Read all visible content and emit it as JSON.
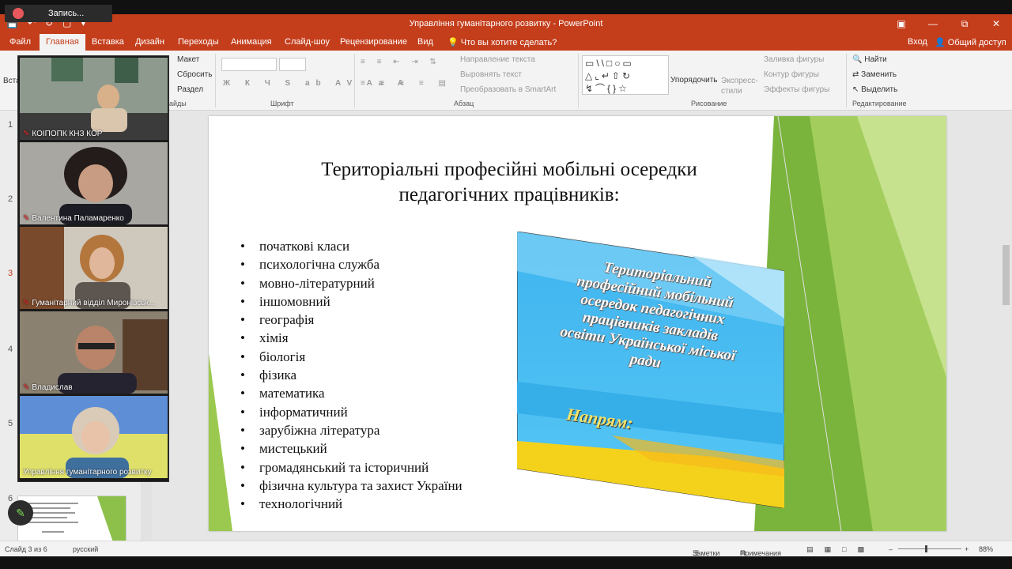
{
  "recording": {
    "label": "Запись..."
  },
  "window": {
    "title": "Управління гуманітарного розвитку - PowerPoint"
  },
  "tabs": [
    {
      "label": "Файл"
    },
    {
      "label": "Главная"
    },
    {
      "label": "Вставка"
    },
    {
      "label": "Дизайн"
    },
    {
      "label": "Переходы"
    },
    {
      "label": "Анимация"
    },
    {
      "label": "Слайд-шоу"
    },
    {
      "label": "Рецензирование"
    },
    {
      "label": "Вид"
    },
    {
      "label": "Что вы хотите сделать?"
    }
  ],
  "account": {
    "login": "Вход",
    "share": "Общий доступ"
  },
  "ribbon": {
    "layout": "Макет",
    "reset": "Сбросить",
    "section": "Раздел",
    "slides_group": "айды",
    "font_group": "Шрифт",
    "paragraph_group": "Абзац",
    "drawing_group": "Рисование",
    "editing_group": "Редактирование",
    "text_direction": "Направление текста",
    "align_text": "Выровнять текст",
    "smartart": "Преобразовать в SmartArt",
    "arrange": "Упорядочить",
    "quick_styles": "Экспресс-стили",
    "shape_fill": "Заливка фигуры",
    "shape_outline": "Контур фигуры",
    "shape_effects": "Эффекты фигуры",
    "find": "Найти",
    "replace": "Заменить",
    "select": "Выделить",
    "insert_abbr": "Вста"
  },
  "slide_numbers": [
    "1",
    "2",
    "3",
    "4",
    "5",
    "6"
  ],
  "participants": [
    {
      "name": "КОІПОПК КНЗ КОР"
    },
    {
      "name": "Валентина Паламаренко"
    },
    {
      "name": "Гуманітарний відділ Миронівськ..."
    },
    {
      "name": "Владислав"
    },
    {
      "name": "Управління гуманітарного розвитку"
    }
  ],
  "slide": {
    "title_line1": "Територіальні професійні мобільні осередки",
    "title_line2": "педагогічних працівників:",
    "bullets": [
      "початкові класи",
      "психологічна служба",
      "мовно-літературний",
      "іншомовний",
      "географія",
      "хімія",
      "біологія",
      "фізика",
      "математика",
      "інформатичний",
      "зарубіжна література",
      "мистецький",
      "громадянський та історичний",
      "фізична культура та захист України",
      "технологічний"
    ],
    "poster_lines": [
      "Територіальний",
      "професійний мобільний",
      "осередок педагогічних",
      "працівників закладів",
      "освіти Української міської",
      "ради"
    ],
    "poster_direction": "Напрям:"
  },
  "status": {
    "slide_info": "Слайд 3 из 6",
    "language": "русский",
    "notes": "Заметки",
    "comments": "Примечания",
    "zoom": "88%"
  },
  "colors": {
    "accent": "#c43e1c",
    "green_dark": "#6aa832",
    "green_light": "#a4cf5c"
  }
}
